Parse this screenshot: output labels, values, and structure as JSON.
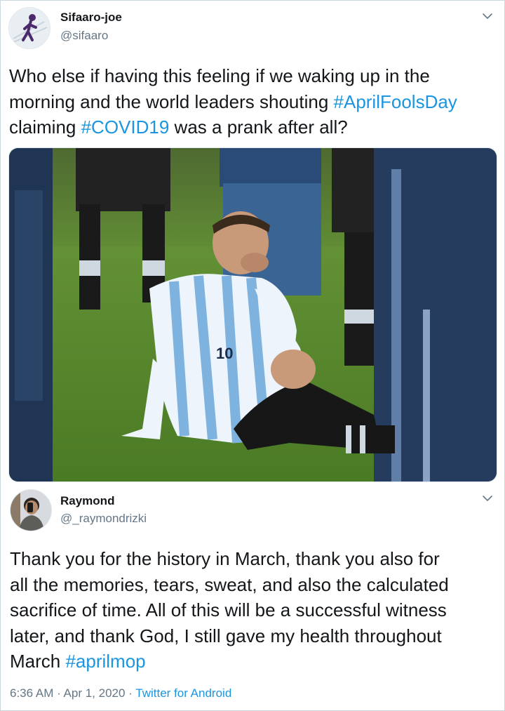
{
  "tweet1": {
    "name": "Sifaaro-joe",
    "handle": "@sifaaro",
    "text_line1": "Who else if having this feeling if we waking up in the",
    "text_line2_pre": "morning and the world leaders shouting ",
    "hashtag1": "#AprilFoolsDay",
    "text_line3_pre": "claiming ",
    "hashtag2": "#COVID19",
    "text_line3_post": " was a prank after all?",
    "image": {
      "jersey_number": "10",
      "icon": "photo-soccer-player-sitting-on-pitch"
    },
    "menu_icon": "chevron-down-icon"
  },
  "tweet2": {
    "name": "Raymond",
    "handle": "@_raymondrizki",
    "line1": "Thank you for the history in March, thank you also for",
    "line2": "all the memories, tears, sweat, and also the calculated",
    "line3": "sacrifice of time. All of this will be a successful witness",
    "line4": "later, and thank God, I still gave my health throughout",
    "line5_pre": "March ",
    "hashtag": "#aprilmop",
    "menu_icon": "chevron-down-icon"
  },
  "meta": {
    "time": "6:36 AM",
    "sep1": " · ",
    "date": "Apr 1, 2020",
    "sep2": " · ",
    "source": "Twitter for Android"
  },
  "colors": {
    "link": "#1b95e0",
    "muted": "#657786",
    "text": "#14171a",
    "border": "#ccd6dd"
  }
}
